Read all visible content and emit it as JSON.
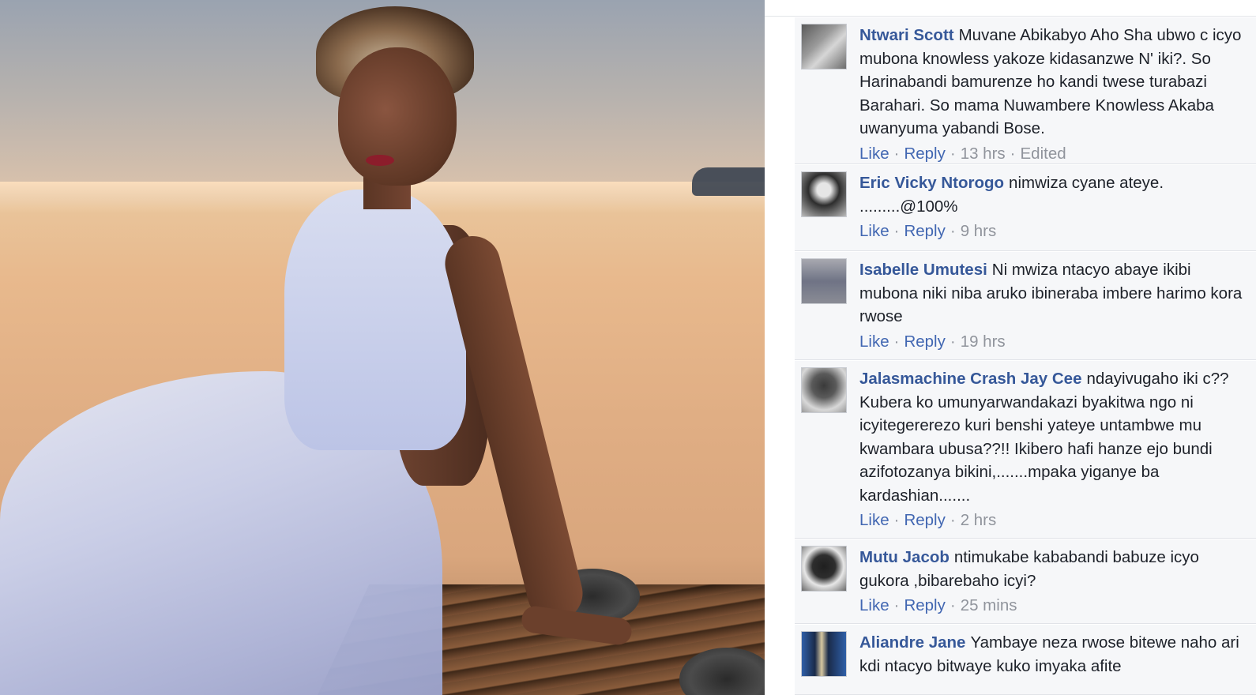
{
  "photo": {
    "description_icon": "portrait-photo"
  },
  "colors": {
    "author_link": "#365899",
    "action_link": "#4267b2",
    "meta_text": "#90949c",
    "comment_bg": "#f6f7f9",
    "body_text": "#1d2129"
  },
  "comments": [
    {
      "author": "Ntwari Scott",
      "text": "Muvane Abikabyo Aho Sha ubwo c icyo mubona knowless yakoze kidasanzwe N' iki?. So Harinabandi bamurenze ho kandi twese turabazi Barahari. So mama Nuwambere Knowless Akaba uwanyuma yabandi Bose.",
      "like": "Like",
      "reply": "Reply",
      "time": "13 hrs",
      "edited": "Edited"
    },
    {
      "author": "Eric Vicky Ntorogo",
      "text": "nimwiza cyane ateye. .........@100%",
      "like": "Like",
      "reply": "Reply",
      "time": "9 hrs"
    },
    {
      "author": "Isabelle Umutesi",
      "text": "Ni mwiza ntacyo abaye ikibi mubona niki niba aruko ibineraba imbere harimo kora rwose",
      "like": "Like",
      "reply": "Reply",
      "time": "19 hrs"
    },
    {
      "author": "Jalasmachine Crash Jay Cee",
      "text": "ndayivugaho iki c?? Kubera ko umunyarwandakazi byakitwa ngo ni icyitegererezo kuri benshi yateye untambwe mu kwambara ubusa??!! Ikibero hafi hanze ejo bundi azifotozanya bikini,.......mpaka yiganye ba kardashian.......",
      "like": "Like",
      "reply": "Reply",
      "time": "2 hrs"
    },
    {
      "author": "Mutu Jacob",
      "text": "ntimukabe kababandi babuze icyo gukora ,bibarebaho icyi?",
      "like": "Like",
      "reply": "Reply",
      "time": "25 mins"
    },
    {
      "author": "Aliandre Jane",
      "text": "Yambaye neza rwose bitewe naho ari kdi ntacyo bitwaye kuko imyaka afite"
    }
  ]
}
